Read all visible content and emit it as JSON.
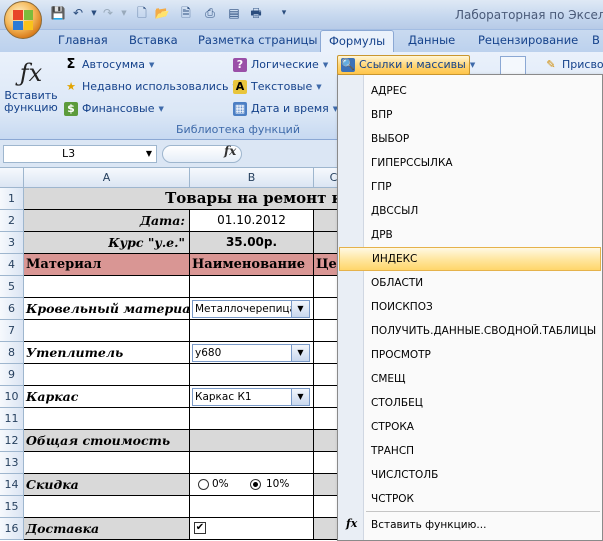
{
  "title_bar": {
    "window_title": "Лабораторная по Экселю"
  },
  "tabs": [
    "Главная",
    "Вставка",
    "Разметка страницы",
    "Формулы",
    "Данные",
    "Рецензирование",
    "В"
  ],
  "ribbon": {
    "insert_function": "Вставить функцию",
    "autosum": "Автосумма",
    "recently_used": "Недавно использовались",
    "financial": "Финансовые",
    "logical": "Логические",
    "text": "Текстовые",
    "date_time": "Дата и время",
    "lookup": "Ссылки и массивы",
    "group_label": "Библиотека функций",
    "assign_name": "Присво"
  },
  "formula_bar": {
    "cell_ref": "L3",
    "fx": "fx"
  },
  "sheet": {
    "columns": [
      "A",
      "B",
      "C"
    ],
    "rows": [
      "1",
      "2",
      "3",
      "4",
      "5",
      "6",
      "7",
      "8",
      "9",
      "10",
      "11",
      "12",
      "13",
      "14",
      "15",
      "16"
    ],
    "title": "Товары на ремонт кр",
    "date_label": "Дата:",
    "date_value": "01.10.2012",
    "rate_label": "Курс \"у.е.\"",
    "rate_value": "35.00р.",
    "header_material": "Материал",
    "header_name": "Наименование",
    "header_price": "Це",
    "roof_label": "Кровельный материал",
    "roof_value": "Металлочерепица",
    "insulation_label": "Утеплитель",
    "insulation_value": "у680",
    "frame_label": "Каркас",
    "frame_value": "Каркас К1",
    "total_label": "Общая стоимость",
    "discount_label": "Скидка",
    "discount_opt1": "0%",
    "discount_opt2": "10%",
    "discount_selected": "10%",
    "delivery_label": "Доставка",
    "delivery_checked": true
  },
  "menu": {
    "items": [
      "АДРЕС",
      "ВПР",
      "ВЫБОР",
      "ГИПЕРССЫЛКА",
      "ГПР",
      "ДВССЫЛ",
      "ДРВ",
      "ИНДЕКС",
      "ОБЛАСТИ",
      "ПОИСКПОЗ",
      "ПОЛУЧИТЬ.ДАННЫЕ.СВОДНОЙ.ТАБЛИЦЫ",
      "ПРОСМОТР",
      "СМЕЩ",
      "СТОЛБЕЦ",
      "СТРОКА",
      "ТРАНСП",
      "ЧИСЛСТОЛБ",
      "ЧСТРОК"
    ],
    "highlighted": "ИНДЕКС",
    "insert_function": "Вставить функцию...",
    "fx": "fx"
  },
  "colors": {
    "accent": "#15428b",
    "highlight": "#ffd66b",
    "header_fill": "#d99694",
    "grey_fill": "#d9d9d9"
  }
}
